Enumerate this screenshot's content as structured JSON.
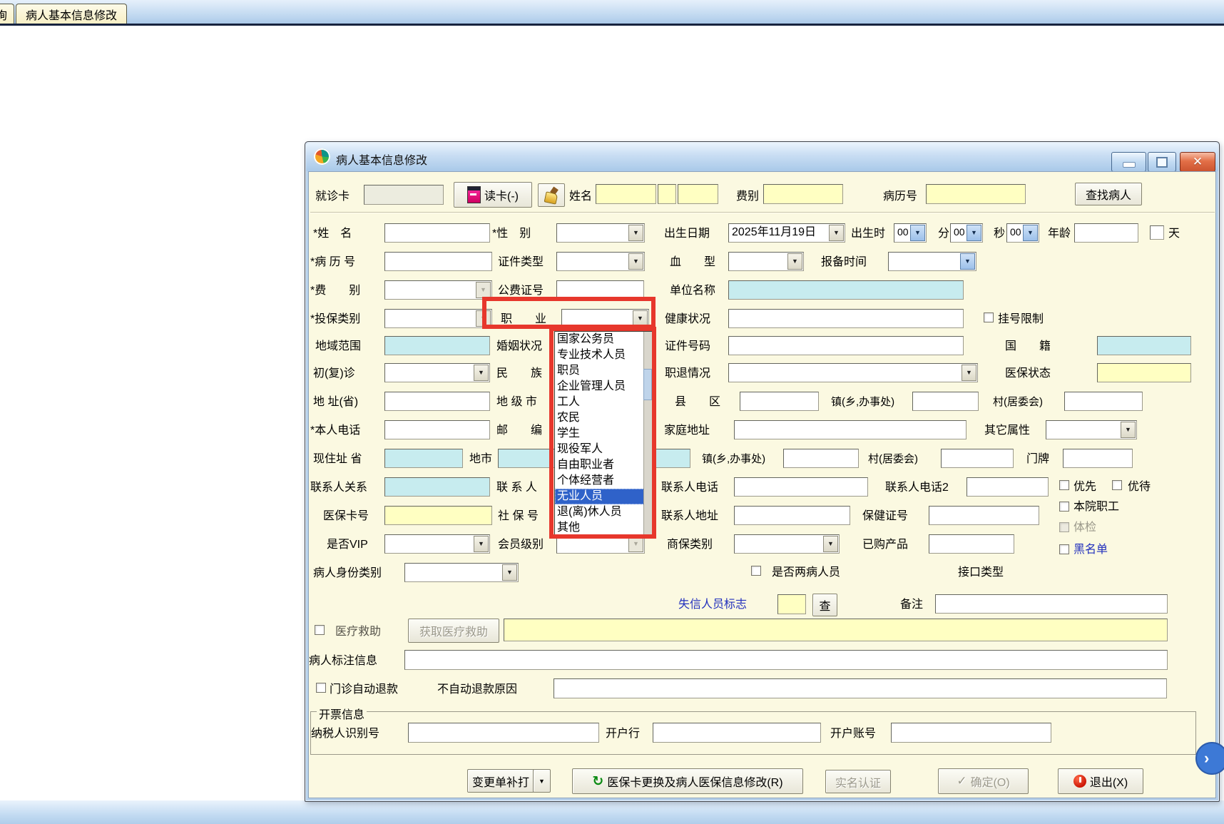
{
  "tab_bar": {
    "partial_tab": "询",
    "active_tab": "病人基本信息修改"
  },
  "window": {
    "title": "病人基本信息修改"
  },
  "header_row": {
    "visit_card_label": "就诊卡",
    "read_card_button": "读卡(-)",
    "name_label": "姓名",
    "fee_type_label": "费别",
    "case_no_label": "病历号",
    "find_patient_button": "查找病人"
  },
  "form": {
    "surname_label": "*姓　名",
    "gender_label": "*性　别",
    "birth_date_label": "出生日期",
    "birth_date_value": "2025年11月19日",
    "birth_hour_label": "出生时",
    "hour_value": "00",
    "minute_label": "分",
    "minute_value": "00",
    "second_label": "秒",
    "second_value": "00",
    "age_label": "年龄",
    "day_label": "天",
    "case_no_label": "*病 历 号",
    "id_type_label": "证件类型",
    "blood_type_label": "血　　型",
    "report_time_label": "报备时间",
    "fee_label": "*费　　别",
    "public_fee_no_label": "公费证号",
    "org_name_label": "单位名称",
    "insure_type_label": "*投保类别",
    "occupation_label": "职　　业",
    "health_label": "健康状况",
    "reg_limit_label": "挂号限制",
    "region_label": "地域范围",
    "marriage_label": "婚姻状况",
    "id_no_label": "证件号码",
    "nationality_label": "国　　籍",
    "first_visit_label": "初(复)诊",
    "ethnic_label": "民　　族",
    "retire_label": "职退情况",
    "medicare_status_label": "医保状态",
    "address_prov_label": "地 址(省)",
    "city_label": "地 级 市",
    "county_label": "县　　区",
    "town_label": "镇(乡,办事处)",
    "village_label": "村(居委会)",
    "phone_label": "*本人电话",
    "postcode_label": "邮　　编",
    "home_addr_label": "家庭地址",
    "other_attr_label": "其它属性",
    "cur_addr_label": "现住址 省",
    "cur_city_label": "地市",
    "town2_label": "镇(乡,办事处)",
    "village2_label": "村(居委会)",
    "door_label": "门牌",
    "contact_rel_label": "联系人关系",
    "contact_label": "联 系 人",
    "contact_phone_label": "联系人电话",
    "contact_phone2_label": "联系人电话2",
    "priority_label": "优先",
    "preferential_label": "优待",
    "medicare_card_label": "医保卡号",
    "social_no_label": "社 保 号",
    "contact_addr_label": "联系人地址",
    "health_cert_label": "保健证号",
    "hospital_staff_label": "本院职工",
    "checkup_label": "体检",
    "blacklist_label": "黑名单",
    "vip_label": "是否VIP",
    "member_level_label": "会员级别",
    "comm_ins_label": "商保类别",
    "purchased_label": "已购产品",
    "identity_label": "病人身份类别",
    "two_disease_label": "是否两病人员",
    "interface_label": "接口类型",
    "dishonest_label": "失信人员标志",
    "check_button": "查",
    "remark_label": "备注",
    "med_aid_label": "医疗救助",
    "get_med_aid_button": "获取医疗救助",
    "patient_note_label": "病人标注信息",
    "auto_refund_label": "门诊自动退款",
    "no_refund_reason_label": "不自动退款原因",
    "invoice_group_label": "开票信息",
    "taxpayer_label": "纳税人识别号",
    "bank_label": "开户行",
    "account_label": "开户账号"
  },
  "occupation_dropdown": {
    "items": [
      "国家公务员",
      "专业技术人员",
      "职员",
      "企业管理人员",
      "工人",
      "农民",
      "学生",
      "现役军人",
      "自由职业者",
      "个体经营者",
      "无业人员",
      "退(离)休人员",
      "其他"
    ],
    "selected": "无业人员",
    "selected_index": 10
  },
  "footer": {
    "reprint_button": "变更单补打",
    "medicare_update_button": "医保卡更换及病人医保信息修改(R)",
    "realname_button": "实名认证",
    "ok_button": "确定(O)",
    "exit_button": "退出(X)"
  },
  "nav": {
    "next_arrow": "›"
  },
  "colors": {
    "highlight_red": "#e7372c",
    "selection_blue": "#2f62c9",
    "field_yellow": "#ffffc2",
    "field_cyan": "#c7ecef",
    "link_blue": "#2230bd"
  }
}
